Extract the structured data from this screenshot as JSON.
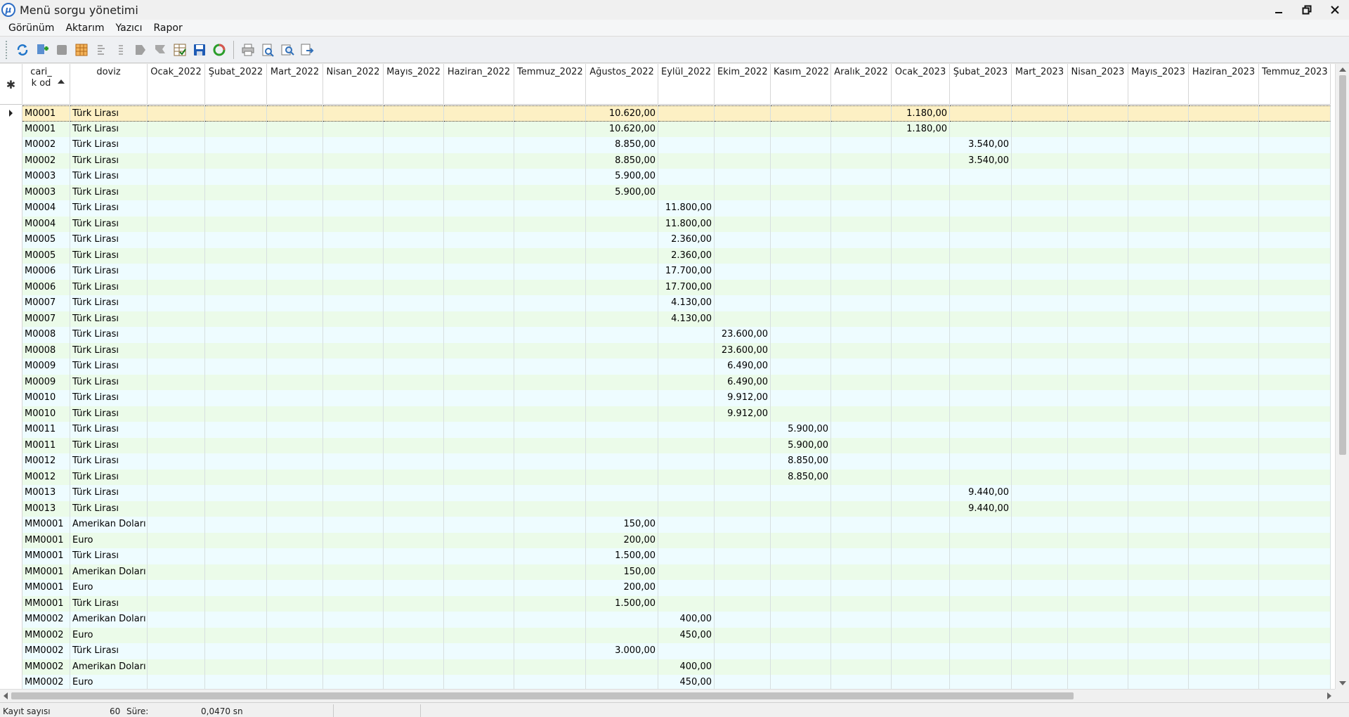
{
  "window": {
    "title": "Menü sorgu yönetimi",
    "icon": "app-logo-icon"
  },
  "menu": [
    "Görünüm",
    "Aktarım",
    "Yazıcı",
    "Rapor"
  ],
  "toolbar": {
    "group1": [
      "refresh-icon",
      "add-record-icon",
      "stop-icon",
      "columns-icon",
      "sort-icon",
      "filter-icon",
      "flag-icon",
      "flag-dim-icon",
      "checklist-icon",
      "save-icon",
      "recycle-icon"
    ],
    "group2": [
      "print-icon",
      "print-preview-icon",
      "zoom-search-icon",
      "export-icon"
    ]
  },
  "grid": {
    "corner_symbol": "✱",
    "columns": [
      "cari_k od",
      "doviz",
      "Ocak_2022",
      "Şubat_2022",
      "Mart_2022",
      "Nisan_2022",
      "Mayıs_2022",
      "Haziran_2022",
      "Temmuz_2022",
      "Ağustos_2022",
      "Eylül_2022",
      "Ekim_2022",
      "Kasım_2022",
      "Aralık_2022",
      "Ocak_2023",
      "Şubat_2023",
      "Mart_2023",
      "Nisan_2023",
      "Mayıs_2023",
      "Haziran_2023",
      "Temmuz_2023"
    ],
    "sorted_column": "cari_k od",
    "rows": [
      {
        "code": "M0001",
        "cur": "Türk Lirası",
        "vals": {
          "Ağustos_2022": "10.620,00",
          "Ocak_2023": "1.180,00"
        }
      },
      {
        "code": "M0001",
        "cur": "Türk Lirası",
        "vals": {
          "Ağustos_2022": "10.620,00",
          "Ocak_2023": "1.180,00"
        }
      },
      {
        "code": "M0002",
        "cur": "Türk Lirası",
        "vals": {
          "Ağustos_2022": "8.850,00",
          "Şubat_2023": "3.540,00"
        }
      },
      {
        "code": "M0002",
        "cur": "Türk Lirası",
        "vals": {
          "Ağustos_2022": "8.850,00",
          "Şubat_2023": "3.540,00"
        }
      },
      {
        "code": "M0003",
        "cur": "Türk Lirası",
        "vals": {
          "Ağustos_2022": "5.900,00"
        }
      },
      {
        "code": "M0003",
        "cur": "Türk Lirası",
        "vals": {
          "Ağustos_2022": "5.900,00"
        }
      },
      {
        "code": "M0004",
        "cur": "Türk Lirası",
        "vals": {
          "Eylül_2022": "11.800,00"
        }
      },
      {
        "code": "M0004",
        "cur": "Türk Lirası",
        "vals": {
          "Eylül_2022": "11.800,00"
        }
      },
      {
        "code": "M0005",
        "cur": "Türk Lirası",
        "vals": {
          "Eylül_2022": "2.360,00"
        }
      },
      {
        "code": "M0005",
        "cur": "Türk Lirası",
        "vals": {
          "Eylül_2022": "2.360,00"
        }
      },
      {
        "code": "M0006",
        "cur": "Türk Lirası",
        "vals": {
          "Eylül_2022": "17.700,00"
        }
      },
      {
        "code": "M0006",
        "cur": "Türk Lirası",
        "vals": {
          "Eylül_2022": "17.700,00"
        }
      },
      {
        "code": "M0007",
        "cur": "Türk Lirası",
        "vals": {
          "Eylül_2022": "4.130,00"
        }
      },
      {
        "code": "M0007",
        "cur": "Türk Lirası",
        "vals": {
          "Eylül_2022": "4.130,00"
        }
      },
      {
        "code": "M0008",
        "cur": "Türk Lirası",
        "vals": {
          "Ekim_2022": "23.600,00"
        }
      },
      {
        "code": "M0008",
        "cur": "Türk Lirası",
        "vals": {
          "Ekim_2022": "23.600,00"
        }
      },
      {
        "code": "M0009",
        "cur": "Türk Lirası",
        "vals": {
          "Ekim_2022": "6.490,00"
        }
      },
      {
        "code": "M0009",
        "cur": "Türk Lirası",
        "vals": {
          "Ekim_2022": "6.490,00"
        }
      },
      {
        "code": "M0010",
        "cur": "Türk Lirası",
        "vals": {
          "Ekim_2022": "9.912,00"
        }
      },
      {
        "code": "M0010",
        "cur": "Türk Lirası",
        "vals": {
          "Ekim_2022": "9.912,00"
        }
      },
      {
        "code": "M0011",
        "cur": "Türk Lirası",
        "vals": {
          "Kasım_2022": "5.900,00"
        }
      },
      {
        "code": "M0011",
        "cur": "Türk Lirası",
        "vals": {
          "Kasım_2022": "5.900,00"
        }
      },
      {
        "code": "M0012",
        "cur": "Türk Lirası",
        "vals": {
          "Kasım_2022": "8.850,00"
        }
      },
      {
        "code": "M0012",
        "cur": "Türk Lirası",
        "vals": {
          "Kasım_2022": "8.850,00"
        }
      },
      {
        "code": "M0013",
        "cur": "Türk Lirası",
        "vals": {
          "Şubat_2023": "9.440,00"
        }
      },
      {
        "code": "M0013",
        "cur": "Türk Lirası",
        "vals": {
          "Şubat_2023": "9.440,00"
        }
      },
      {
        "code": "MM0001",
        "cur": "Amerikan Doları",
        "vals": {
          "Ağustos_2022": "150,00"
        }
      },
      {
        "code": "MM0001",
        "cur": "Euro",
        "vals": {
          "Ağustos_2022": "200,00"
        }
      },
      {
        "code": "MM0001",
        "cur": "Türk Lirası",
        "vals": {
          "Ağustos_2022": "1.500,00"
        }
      },
      {
        "code": "MM0001",
        "cur": "Amerikan Doları",
        "vals": {
          "Ağustos_2022": "150,00"
        }
      },
      {
        "code": "MM0001",
        "cur": "Euro",
        "vals": {
          "Ağustos_2022": "200,00"
        }
      },
      {
        "code": "MM0001",
        "cur": "Türk Lirası",
        "vals": {
          "Ağustos_2022": "1.500,00"
        }
      },
      {
        "code": "MM0002",
        "cur": "Amerikan Doları",
        "vals": {
          "Eylül_2022": "400,00"
        }
      },
      {
        "code": "MM0002",
        "cur": "Euro",
        "vals": {
          "Eylül_2022": "450,00"
        }
      },
      {
        "code": "MM0002",
        "cur": "Türk Lirası",
        "vals": {
          "Ağustos_2022": "3.000,00"
        }
      },
      {
        "code": "MM0002",
        "cur": "Amerikan Doları",
        "vals": {
          "Eylül_2022": "400,00"
        }
      },
      {
        "code": "MM0002",
        "cur": "Euro",
        "vals": {
          "Eylül_2022": "450,00"
        }
      }
    ],
    "current_row": 0,
    "colors": {
      "odd_row": "#eefcff",
      "even_row": "#ebfbe9",
      "current_row": "#fdf0c4"
    }
  },
  "status": {
    "record_label": "Kayıt sayısı",
    "record_count": "60",
    "time_label": "Süre:",
    "time_value": "0,0470 sn"
  }
}
